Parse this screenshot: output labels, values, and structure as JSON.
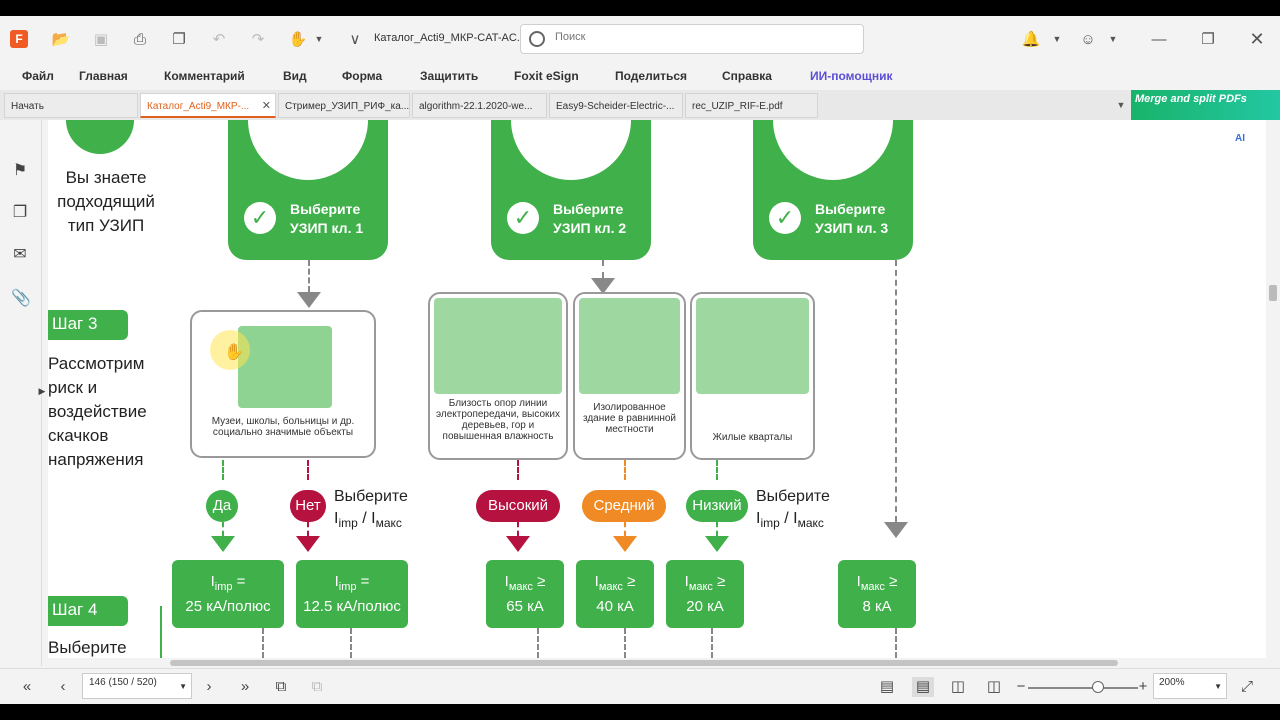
{
  "window": {
    "title": "Каталог_Acti9_МКР-CAT-AC...",
    "search_placeholder": "Поиск"
  },
  "menu": [
    "Файл",
    "Главная",
    "Комментарий",
    "Вид",
    "Форма",
    "Защитить",
    "Foxit eSign",
    "Поделиться",
    "Справка",
    "ИИ-помощник"
  ],
  "tabs": [
    {
      "label": "Начать"
    },
    {
      "label": "Каталог_Acti9_МКР-..."
    },
    {
      "label": "Стример_УЗИП_РИФ_ка..."
    },
    {
      "label": "algorithm-22.1.2020-we..."
    },
    {
      "label": "Easy9-Scheider-Electric-..."
    },
    {
      "label": "rec_UZIP_RIF-E.pdf"
    }
  ],
  "merge_banner": "Merge and split PDFs",
  "document": {
    "intro_text": [
      "Вы знаете",
      "подходящий",
      "тип УЗИП"
    ],
    "cards": [
      {
        "line1": "Выберите",
        "line2": "УЗИП кл. 1"
      },
      {
        "line1": "Выберите",
        "line2": "УЗИП кл. 2"
      },
      {
        "line1": "Выберите",
        "line2": "УЗИП кл. 3"
      }
    ],
    "step3": {
      "tag": "Шаг 3",
      "text": [
        "Рассмотрим",
        "риск и",
        "воздействие",
        "скачков",
        "напряжения"
      ]
    },
    "step4": {
      "tag": "Шаг 4",
      "text": "Выберите"
    },
    "boxes": [
      {
        "caption": "Музеи, школы, больницы и др. социально значимые объекты"
      },
      {
        "caption": "Близость опор линии электропередачи, высоких деревьев, гор и повышенная влажность"
      },
      {
        "caption": "Изолированное здание в равнинной местности"
      },
      {
        "caption": "Жилые кварталы"
      }
    ],
    "pills": [
      {
        "label": "Да",
        "color": "#3fb04a"
      },
      {
        "label": "Нет",
        "color": "#b5123f"
      },
      {
        "label": "Высокий",
        "color": "#b5123f"
      },
      {
        "label": "Средний",
        "color": "#f08a24"
      },
      {
        "label": "Низкий",
        "color": "#3fb04a"
      }
    ],
    "choose_labels": [
      {
        "line1": "Выберите",
        "i1": "I",
        "s1": "imp",
        "sep": " / ",
        "i2": "I",
        "s2": "макс"
      },
      {
        "line1": "Выберите",
        "i1": "I",
        "s1": "imp",
        "sep": " / ",
        "i2": "I",
        "s2": "макс"
      }
    ],
    "results": [
      {
        "sym": "I",
        "sub": "imp",
        "op": " =",
        "value": "25 кА/полюс"
      },
      {
        "sym": "I",
        "sub": "imp",
        "op": " =",
        "value": "12.5 кА/полюс"
      },
      {
        "sym": "I",
        "sub": "макс",
        "op": " ≥",
        "value": "65 кА"
      },
      {
        "sym": "I",
        "sub": "макс",
        "op": " ≥",
        "value": "40 кА"
      },
      {
        "sym": "I",
        "sub": "макс",
        "op": " ≥",
        "value": "20 кА"
      },
      {
        "sym": "I",
        "sub": "макс",
        "op": " ≥",
        "value": "8 кА"
      }
    ]
  },
  "status": {
    "page": "146 (150 / 520)",
    "zoom": "200%"
  },
  "colors": {
    "brand_green": "#3fb04a",
    "red": "#b5123f",
    "orange": "#f08a24",
    "active_tab": "#e0601c",
    "ai_menu": "#5b4fd6"
  }
}
